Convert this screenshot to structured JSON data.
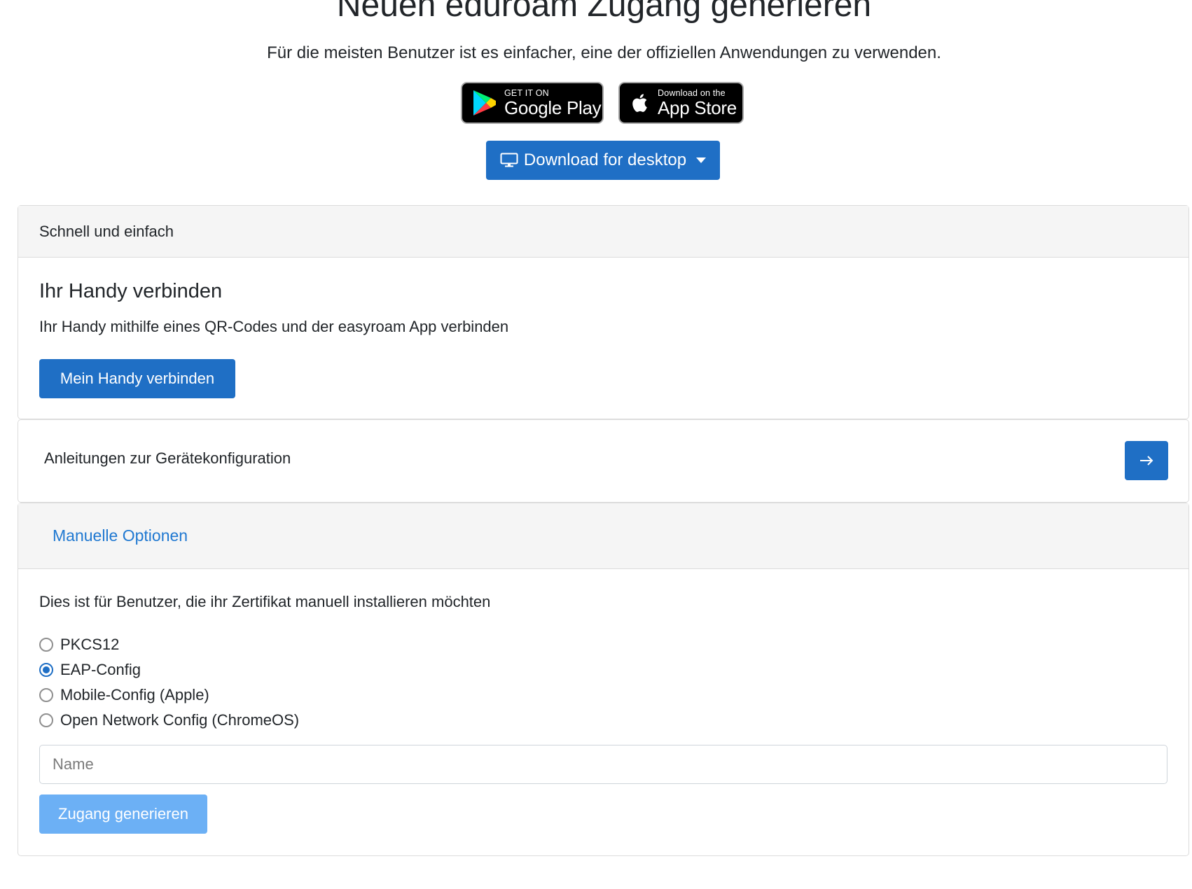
{
  "header": {
    "title": "Neuen eduroam Zugang generieren",
    "subtitle": "Für die meisten Benutzer ist es einfacher, eine der offiziellen Anwendungen zu verwenden."
  },
  "stores": {
    "google": {
      "small": "GET IT ON",
      "big": "Google Play"
    },
    "apple": {
      "small": "Download on the",
      "big": "App Store"
    }
  },
  "desktop_download": {
    "label": "Download for desktop",
    "icon": "monitor-icon"
  },
  "quick_card": {
    "header": "Schnell und einfach",
    "title": "Ihr Handy verbinden",
    "text": "Ihr Handy mithilfe eines QR-Codes und der easyroam App verbinden",
    "button": "Mein Handy verbinden"
  },
  "guides": {
    "label": "Anleitungen zur Gerätekonfiguration",
    "button_icon": "arrow-right-icon"
  },
  "manual": {
    "header": "Manuelle Optionen",
    "description": "Dies ist für Benutzer, die ihr Zertifikat manuell installieren möchten",
    "options": [
      {
        "label": "PKCS12",
        "checked": false
      },
      {
        "label": "EAP-Config",
        "checked": true
      },
      {
        "label": "Mobile-Config (Apple)",
        "checked": false
      },
      {
        "label": "Open Network Config (ChromeOS)",
        "checked": false
      }
    ],
    "name_placeholder": "Name",
    "name_value": "",
    "submit": "Zugang generieren"
  },
  "colors": {
    "primary": "#1f6fc5",
    "primary_disabled": "#6cb0f5",
    "link": "#1f78d1",
    "card_header_bg": "#f5f5f5"
  }
}
